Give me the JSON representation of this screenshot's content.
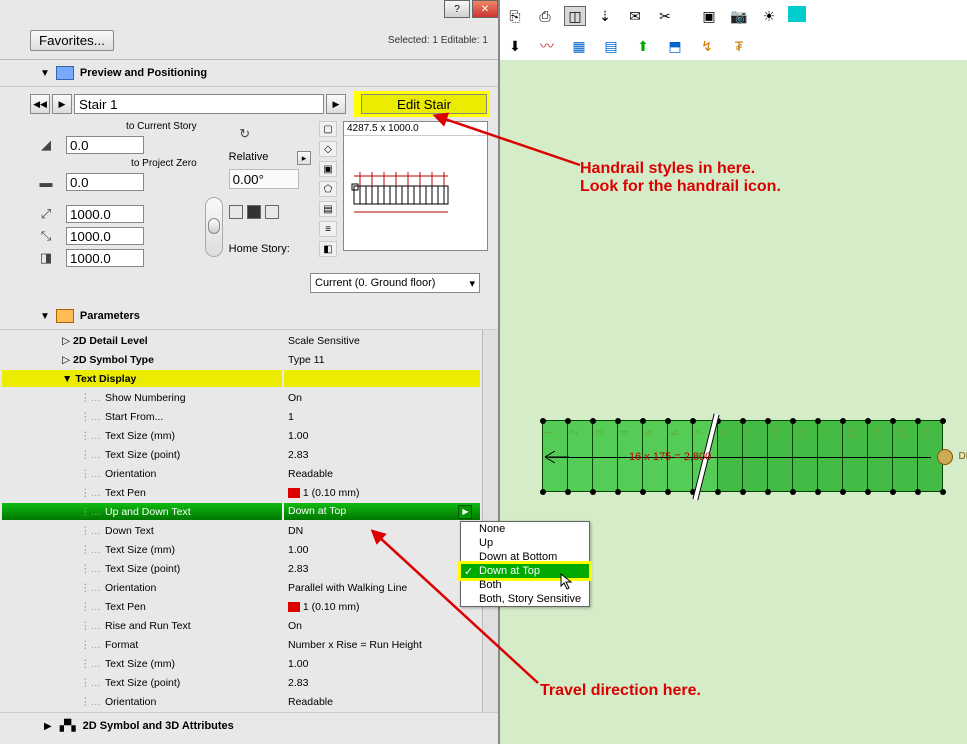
{
  "window": {
    "help_label": "?",
    "close_label": "✕"
  },
  "topbar": {
    "favorites_label": "Favorites...",
    "status": "Selected: 1 Editable: 1"
  },
  "sections": {
    "preview_positioning": "Preview and Positioning",
    "parameters": "Parameters",
    "symbol_3d": "2D Symbol and 3D Attributes"
  },
  "preview": {
    "name_value": "Stair 1",
    "edit_stair_label": "Edit Stair",
    "to_current_story": "to Current Story",
    "to_project_zero": "to Project Zero",
    "z1": "0.0",
    "z2": "0.0",
    "dim1": "1000.0",
    "dim2": "1000.0",
    "dim3": "1000.0",
    "relative_label": "Relative",
    "angle": "0.00°",
    "home_story_label": "Home Story:",
    "home_story_value": "Current (0. Ground floor)",
    "preview_dims": "4287.5 x 1000.0"
  },
  "params": {
    "rows": [
      {
        "k": "2D Detail Level",
        "v": "Scale Sensitive",
        "indent": 1,
        "tri": true
      },
      {
        "k": "2D Symbol Type",
        "v": "Type 11",
        "indent": 1,
        "tri": true
      },
      {
        "k": "Text Display",
        "v": "",
        "indent": 1,
        "tri": true,
        "hl": "yellow"
      },
      {
        "k": "Show Numbering",
        "v": "On",
        "indent": 2
      },
      {
        "k": "Start From...",
        "v": "1",
        "indent": 2
      },
      {
        "k": "Text Size (mm)",
        "v": "1.00",
        "indent": 2
      },
      {
        "k": "Text Size (point)",
        "v": "2.83",
        "indent": 2
      },
      {
        "k": "Orientation",
        "v": "Readable",
        "indent": 2
      },
      {
        "k": "Text Pen",
        "v": "1 (0.10 mm)",
        "indent": 2,
        "pen": true
      },
      {
        "k": "Up and Down Text",
        "v": "Down at Top",
        "indent": 2,
        "hl": "green",
        "play": true
      },
      {
        "k": "Down Text",
        "v": "DN",
        "indent": 2
      },
      {
        "k": "Text Size (mm)",
        "v": "1.00",
        "indent": 2
      },
      {
        "k": "Text Size (point)",
        "v": "2.83",
        "indent": 2
      },
      {
        "k": "Orientation",
        "v": "Parallel with Walking Line",
        "indent": 2
      },
      {
        "k": "Text Pen",
        "v": "1 (0.10 mm)",
        "indent": 2,
        "pen": true
      },
      {
        "k": "Rise and Run Text",
        "v": "On",
        "indent": 2
      },
      {
        "k": "Format",
        "v": "Number x Rise = Run Height",
        "indent": 2
      },
      {
        "k": "Text Size (mm)",
        "v": "1.00",
        "indent": 2
      },
      {
        "k": "Text Size (point)",
        "v": "2.83",
        "indent": 2
      },
      {
        "k": "Orientation",
        "v": "Readable",
        "indent": 2
      }
    ]
  },
  "popup": {
    "items": [
      "None",
      "Up",
      "Down at Bottom",
      "Down at Top",
      "Both",
      "Both, Story Sensitive"
    ],
    "selected_index": 3
  },
  "annotations": {
    "handrail1": "Handrail styles in here.",
    "handrail2": "Look for the handrail icon.",
    "travel": "Travel direction here."
  },
  "stair": {
    "label": "16 x 175 = 2,800",
    "dn": "DN",
    "treads": 16
  }
}
